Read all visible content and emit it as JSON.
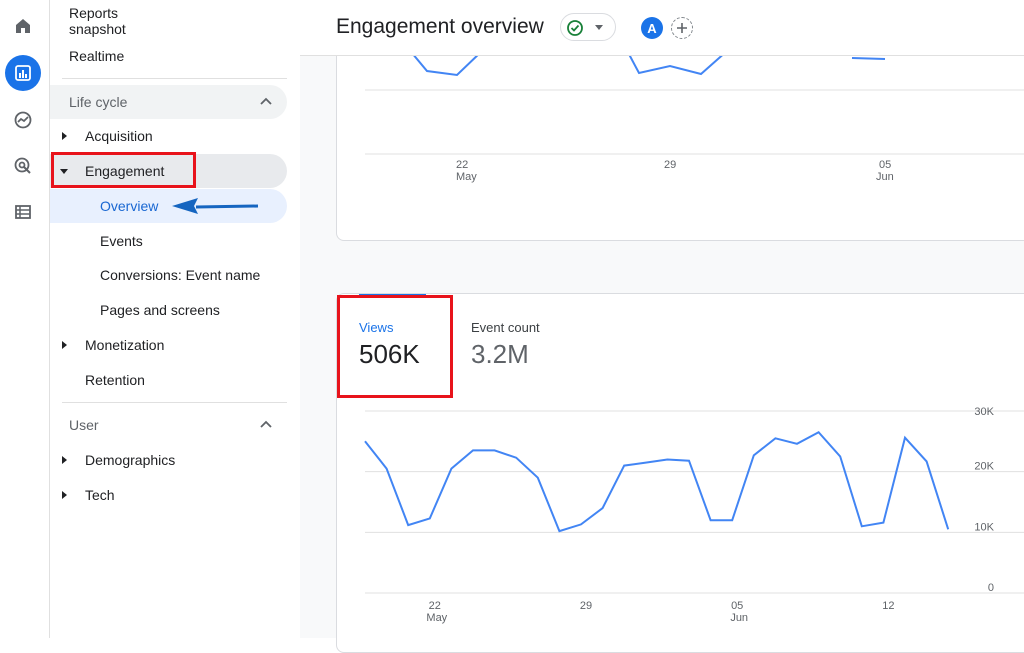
{
  "nav": {
    "reports_snapshot": "Reports snapshot",
    "realtime": "Realtime",
    "lifecycle_section": "Life cycle",
    "acquisition": "Acquisition",
    "engagement": "Engagement",
    "overview": "Overview",
    "events": "Events",
    "conversions": "Conversions: Event name",
    "pages_screens": "Pages and screens",
    "monetization": "Monetization",
    "retention": "Retention",
    "user_section": "User",
    "demographics": "Demographics",
    "tech": "Tech"
  },
  "header": {
    "title": "Engagement overview",
    "avatar_letter": "A"
  },
  "top_chart": {
    "x_ticks": [
      {
        "day": "22",
        "month": "May"
      },
      {
        "day": "29",
        "month": ""
      },
      {
        "day": "05",
        "month": "Jun"
      }
    ]
  },
  "metrics_card": {
    "tab_views_label": "Views",
    "tab_views_value": "506K",
    "tab_events_label": "Event count",
    "tab_events_value": "3.2M"
  },
  "chart_data": {
    "type": "line",
    "series": [
      {
        "values": [
          25000,
          20500,
          11200,
          12300,
          20500,
          23500,
          23500,
          22300,
          19000,
          10200,
          11300,
          14000,
          21000,
          21500,
          22000,
          21800,
          12000,
          12000,
          22700,
          25500,
          24600,
          26500,
          22500,
          11000,
          11600,
          25600,
          21700,
          10500
        ]
      }
    ],
    "x_ticks": [
      {
        "day": "22",
        "month": "May"
      },
      {
        "day": "29",
        "month": ""
      },
      {
        "day": "05",
        "month": "Jun"
      },
      {
        "day": "12",
        "month": ""
      }
    ],
    "y_ticks": [
      "30K",
      "20K",
      "10K",
      "0"
    ],
    "ylim": [
      0,
      30000
    ],
    "grid": true
  },
  "colors": {
    "accent": "#1a73e8",
    "line": "#4285f4",
    "highlight": "#e8131b",
    "arrow": "#1565c0"
  }
}
